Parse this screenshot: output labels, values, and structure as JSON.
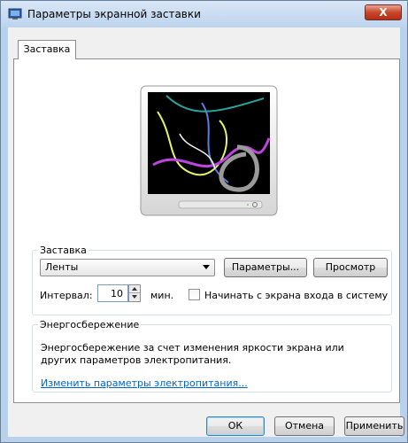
{
  "window": {
    "title": "Параметры экранной заставки",
    "close_label": "X"
  },
  "tab": {
    "label": "Заставка"
  },
  "screensaver_group": {
    "legend": "Заставка",
    "selected": "Ленты",
    "params_button": "Параметры...",
    "preview_button": "Просмотр",
    "interval_label": "Интервал:",
    "interval_value": "10",
    "interval_unit": "мин.",
    "logon_checkbox_label": "Начинать с экрана входа в систему",
    "logon_checked": false
  },
  "power_group": {
    "legend": "Энергосбережение",
    "description": "Энергосбережение за счет изменения яркости экрана или других параметров электропитания.",
    "link": "Изменить параметры электропитания..."
  },
  "buttons": {
    "ok": "ОК",
    "cancel": "Отмена",
    "apply": "Применить"
  },
  "icons": {
    "app": "screensaver-app-icon",
    "monitor": "monitor-preview"
  },
  "colors": {
    "link": "#0066cc",
    "close_button": "#c7472a",
    "ribbon_colors": [
      "#e6f26a",
      "#c044e0",
      "#5a7fe0",
      "#9a9a9a",
      "#2aa3a0"
    ]
  }
}
